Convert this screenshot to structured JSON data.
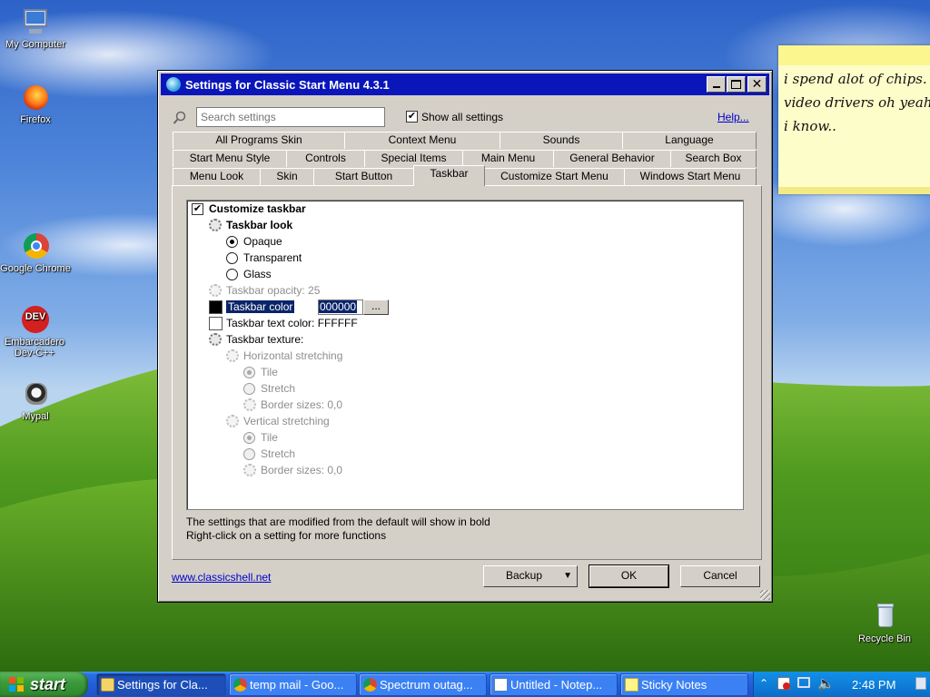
{
  "desktop": {
    "icons": [
      {
        "label": "My Computer",
        "icon": "computer-icon"
      },
      {
        "label": "Firefox",
        "icon": "firefox-icon"
      },
      {
        "label": "Google Chrome",
        "icon": "chrome-icon"
      },
      {
        "label": "Embarcadero Dev-C++",
        "icon": "devcpp-icon"
      },
      {
        "label": "Mypal",
        "icon": "mypal-icon"
      },
      {
        "label": "Recycle Bin",
        "icon": "recycle-bin-icon"
      }
    ]
  },
  "sticky_note": {
    "lines": [
      "i spend alot of chips.",
      "video drivers oh yeah",
      "i know.."
    ]
  },
  "dialog": {
    "title": "Settings for Classic Start Menu 4.3.1",
    "search_placeholder": "Search settings",
    "show_all_label": "Show all settings",
    "show_all_checked": true,
    "help_label": "Help...",
    "tabs_row1": [
      "All Programs Skin",
      "Context Menu",
      "Sounds",
      "Language"
    ],
    "tabs_row2": [
      "Start Menu Style",
      "Controls",
      "Special Items",
      "Main Menu",
      "General Behavior",
      "Search Box"
    ],
    "tabs_row3": [
      "Menu Look",
      "Skin",
      "Start Button",
      "Taskbar",
      "Customize Start Menu",
      "Windows Start Menu"
    ],
    "active_tab": "Taskbar",
    "tree": {
      "customize_taskbar": "Customize taskbar",
      "taskbar_look": "Taskbar look",
      "opaque": "Opaque",
      "transparent": "Transparent",
      "glass": "Glass",
      "taskbar_opacity": "Taskbar opacity: 25",
      "taskbar_color_label": "Taskbar color",
      "taskbar_color_value": "000000",
      "browse_label": "...",
      "taskbar_text_color": "Taskbar text color: FFFFFF",
      "taskbar_texture": "Taskbar texture:",
      "horizontal_stretching": "Horizontal stretching",
      "h_tile": "Tile",
      "h_stretch": "Stretch",
      "h_border": "Border sizes: 0,0",
      "vertical_stretching": "Vertical stretching",
      "v_tile": "Tile",
      "v_stretch": "Stretch",
      "v_border": "Border sizes: 0,0"
    },
    "hint_line1": "The settings that are modified from the default will show in bold",
    "hint_line2": "Right-click on a setting for more functions",
    "site_link": "www.classicshell.net",
    "backup_label": "Backup",
    "ok_label": "OK",
    "cancel_label": "Cancel",
    "colors": {
      "title_bar": "#0a16ba",
      "selection": "#0a246a"
    }
  },
  "taskbar": {
    "start_label": "start",
    "tasks": [
      {
        "label": "Settings for Cla...",
        "icon": "folder-icon"
      },
      {
        "label": "temp mail - Goo...",
        "icon": "chrome-icon"
      },
      {
        "label": "Spectrum outag...",
        "icon": "chrome-icon"
      },
      {
        "label": "Untitled - Notep...",
        "icon": "notepad-icon"
      },
      {
        "label": "Sticky Notes",
        "icon": "sticky-notes-icon"
      }
    ],
    "clock": "2:48 PM"
  }
}
